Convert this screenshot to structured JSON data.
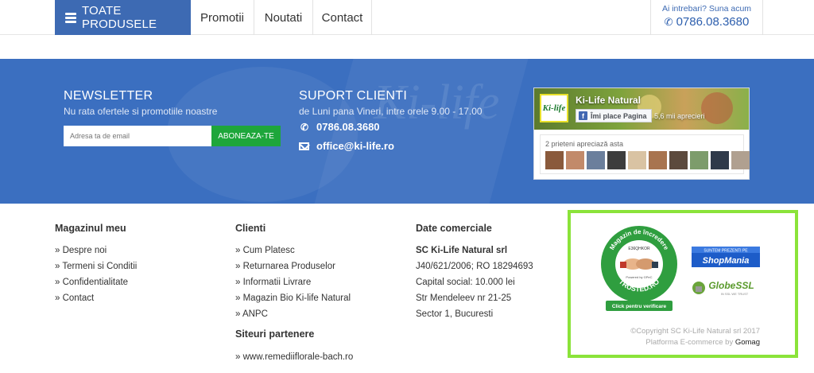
{
  "nav": {
    "all_products": "TOATE PRODUSELE",
    "items": [
      "Promotii",
      "Noutati",
      "Contact"
    ],
    "help_question": "Ai intrebari? Suna acum",
    "help_phone": "0786.08.3680"
  },
  "newsletter": {
    "title": "NEWSLETTER",
    "subtitle": "Nu rata ofertele si promotiile noastre",
    "placeholder": "Adresa ta de email",
    "button": "ABONEAZA-TE"
  },
  "support": {
    "title": "SUPORT CLIENTI",
    "hours": "de Luni pana Vineri, intre orele 9.00 - 17.00",
    "phone": "0786.08.3680",
    "email": "office@ki-life.ro"
  },
  "facebook": {
    "page_name": "Ki-Life Natural",
    "logo_text": "Ki-life",
    "like_button": "Îmi place Pagina",
    "like_count": "5,6 mii aprecieri",
    "friends_text": "2 prieteni apreciază asta"
  },
  "footer": {
    "magazin": {
      "title": "Magazinul meu",
      "links": [
        "» Despre noi",
        "» Termeni si Conditii",
        "» Confidentialitate",
        "» Contact"
      ]
    },
    "clienti": {
      "title": "Clienti",
      "links": [
        "» Cum Platesc",
        "» Returnarea Produselor",
        "» Informatii Livrare",
        "» Magazin Bio Ki-life Natural",
        "» ANPC"
      ]
    },
    "parteneri": {
      "title": "Siteuri partenere",
      "link": "» www.remediiflorale-bach.ro"
    },
    "date": {
      "title": "Date comerciale",
      "company": "SC Ki-Life Natural srl",
      "lines": [
        "J40/621/2006; RO 18294693",
        "Capital social: 10.000 lei",
        "Str Mendeleev nr 21-25",
        "Sector 1, Bucuresti"
      ]
    },
    "trust": {
      "seal_top": "Magazin de încredere",
      "seal_bottom": "TRUSTED.RO",
      "seal_code": "E36QHKOR",
      "seal_powered": "Powered by GPeC",
      "seal_button": "Click pentru verificare",
      "shopmania_top": "SUNTEM PREZENTI PE",
      "shopmania_name": "ShopMania",
      "globessl_name": "GlobeSSL",
      "globessl_tag": "IN SSL WE TRUST",
      "copyright": "©Copyright SC Ki-Life Natural srl 2017",
      "platform": "Platforma E-commerce by",
      "platform_brand": "Gomag"
    }
  },
  "colors": {
    "brand_blue": "#3d6ab3",
    "band_blue": "#3b6fc0",
    "green_button": "#1ea63b",
    "trust_border": "#8be33a"
  }
}
